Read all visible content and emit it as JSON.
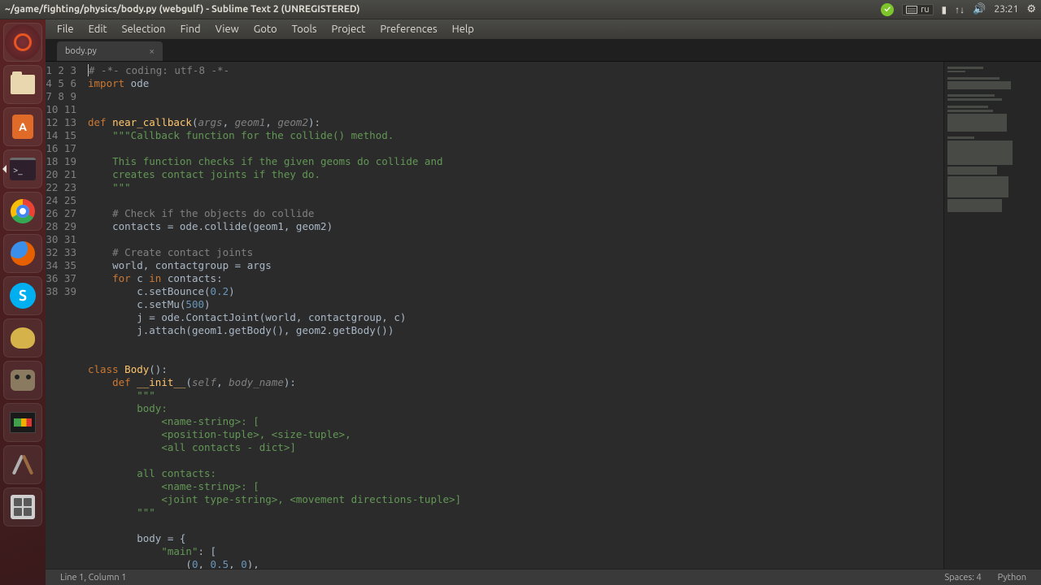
{
  "window": {
    "title": "~/game/fighting/physics/body.py (webgulf) - Sublime Text 2 (UNREGISTERED)"
  },
  "topstatus": {
    "check": "✓",
    "lang": "ru",
    "battery": "▮",
    "updown": "↑↓",
    "sound": "🔊",
    "time": "23:21",
    "gear": "⚙"
  },
  "menubar": [
    "File",
    "Edit",
    "Selection",
    "Find",
    "View",
    "Goto",
    "Tools",
    "Project",
    "Preferences",
    "Help"
  ],
  "tab": {
    "name": "body.py",
    "close": "×"
  },
  "launcher": [
    "ubuntu-dash",
    "files",
    "software-center",
    "terminal",
    "chrome",
    "firefox",
    "skype",
    "teapot",
    "gimp",
    "system-monitor",
    "settings",
    "calculator"
  ],
  "gutter_start": 1,
  "gutter_end": 39,
  "code": [
    {
      "segs": [
        [
          "comment",
          "# -*- coding: utf-8 -*-"
        ]
      ],
      "cursor": true
    },
    {
      "segs": [
        [
          "keyword",
          "import"
        ],
        [
          "def",
          " ode"
        ]
      ]
    },
    {
      "segs": []
    },
    {
      "segs": []
    },
    {
      "segs": [
        [
          "keyword",
          "def"
        ],
        [
          "def",
          " "
        ],
        [
          "name",
          "near_callback"
        ],
        [
          "punc",
          "("
        ],
        [
          "pa",
          "args"
        ],
        [
          "punc",
          ", "
        ],
        [
          "pa",
          "geom1"
        ],
        [
          "punc",
          ", "
        ],
        [
          "pa",
          "geom2"
        ],
        [
          "punc",
          "):"
        ]
      ]
    },
    {
      "segs": [
        [
          "def",
          "    "
        ],
        [
          "string",
          "\"\"\"Callback function for the collide() method."
        ]
      ]
    },
    {
      "segs": []
    },
    {
      "segs": [
        [
          "def",
          "    "
        ],
        [
          "string",
          "This function checks if the given geoms do collide and"
        ]
      ]
    },
    {
      "segs": [
        [
          "def",
          "    "
        ],
        [
          "string",
          "creates contact joints if they do."
        ]
      ]
    },
    {
      "segs": [
        [
          "def",
          "    "
        ],
        [
          "string",
          "\"\"\""
        ]
      ]
    },
    {
      "segs": []
    },
    {
      "segs": [
        [
          "def",
          "    "
        ],
        [
          "comment",
          "# Check if the objects do collide"
        ]
      ]
    },
    {
      "segs": [
        [
          "def",
          "    contacts "
        ],
        [
          "punc",
          "="
        ],
        [
          "def",
          " ode.collide"
        ],
        [
          "punc",
          "("
        ],
        [
          "def",
          "geom1"
        ],
        [
          "punc",
          ", "
        ],
        [
          "def",
          "geom2"
        ],
        [
          "punc",
          ")"
        ]
      ]
    },
    {
      "segs": []
    },
    {
      "segs": [
        [
          "def",
          "    "
        ],
        [
          "comment",
          "# Create contact joints"
        ]
      ]
    },
    {
      "segs": [
        [
          "def",
          "    world"
        ],
        [
          "punc",
          ", "
        ],
        [
          "def",
          "contactgroup "
        ],
        [
          "punc",
          "="
        ],
        [
          "def",
          " args"
        ]
      ]
    },
    {
      "segs": [
        [
          "def",
          "    "
        ],
        [
          "keyword",
          "for"
        ],
        [
          "def",
          " c "
        ],
        [
          "keyword",
          "in"
        ],
        [
          "def",
          " contacts"
        ],
        [
          "punc",
          ":"
        ]
      ]
    },
    {
      "segs": [
        [
          "def",
          "        c.setBounce"
        ],
        [
          "punc",
          "("
        ],
        [
          "number",
          "0.2"
        ],
        [
          "punc",
          ")"
        ]
      ]
    },
    {
      "segs": [
        [
          "def",
          "        c.setMu"
        ],
        [
          "punc",
          "("
        ],
        [
          "number",
          "500"
        ],
        [
          "punc",
          ")"
        ]
      ]
    },
    {
      "segs": [
        [
          "def",
          "        j "
        ],
        [
          "punc",
          "="
        ],
        [
          "def",
          " ode.ContactJoint"
        ],
        [
          "punc",
          "("
        ],
        [
          "def",
          "world"
        ],
        [
          "punc",
          ", "
        ],
        [
          "def",
          "contactgroup"
        ],
        [
          "punc",
          ", "
        ],
        [
          "def",
          "c"
        ],
        [
          "punc",
          ")"
        ]
      ]
    },
    {
      "segs": [
        [
          "def",
          "        j.attach"
        ],
        [
          "punc",
          "("
        ],
        [
          "def",
          "geom1.getBody"
        ],
        [
          "punc",
          "()"
        ],
        [
          "punc",
          ", "
        ],
        [
          "def",
          "geom2.getBody"
        ],
        [
          "punc",
          "())"
        ]
      ]
    },
    {
      "segs": []
    },
    {
      "segs": []
    },
    {
      "segs": [
        [
          "keyword",
          "class"
        ],
        [
          "def",
          " "
        ],
        [
          "name",
          "Body"
        ],
        [
          "punc",
          "():"
        ]
      ]
    },
    {
      "segs": [
        [
          "def",
          "    "
        ],
        [
          "keyword",
          "def"
        ],
        [
          "def",
          " "
        ],
        [
          "name",
          "__init__"
        ],
        [
          "punc",
          "("
        ],
        [
          "pa",
          "self"
        ],
        [
          "punc",
          ", "
        ],
        [
          "pa",
          "body_name"
        ],
        [
          "punc",
          "):"
        ]
      ]
    },
    {
      "segs": [
        [
          "def",
          "        "
        ],
        [
          "string",
          "\"\"\""
        ]
      ]
    },
    {
      "segs": [
        [
          "def",
          "        "
        ],
        [
          "string",
          "body:"
        ]
      ]
    },
    {
      "segs": [
        [
          "def",
          "            "
        ],
        [
          "string",
          "<name-string>: ["
        ]
      ]
    },
    {
      "segs": [
        [
          "def",
          "            "
        ],
        [
          "string",
          "<position-tuple>, <size-tuple>,"
        ]
      ]
    },
    {
      "segs": [
        [
          "def",
          "            "
        ],
        [
          "string",
          "<all contacts - dict>]"
        ]
      ]
    },
    {
      "segs": []
    },
    {
      "segs": [
        [
          "def",
          "        "
        ],
        [
          "string",
          "all contacts:"
        ]
      ]
    },
    {
      "segs": [
        [
          "def",
          "            "
        ],
        [
          "string",
          "<name-string>: ["
        ]
      ]
    },
    {
      "segs": [
        [
          "def",
          "            "
        ],
        [
          "string",
          "<joint type-string>, <movement directions-tuple>]"
        ]
      ]
    },
    {
      "segs": [
        [
          "def",
          "        "
        ],
        [
          "string",
          "\"\"\""
        ]
      ]
    },
    {
      "segs": []
    },
    {
      "segs": [
        [
          "def",
          "        body "
        ],
        [
          "punc",
          "="
        ],
        [
          "def",
          " "
        ],
        [
          "punc",
          "{"
        ]
      ]
    },
    {
      "segs": [
        [
          "def",
          "            "
        ],
        [
          "string",
          "\"main\""
        ],
        [
          "punc",
          ": ["
        ]
      ]
    },
    {
      "segs": [
        [
          "def",
          "                "
        ],
        [
          "punc",
          "("
        ],
        [
          "number",
          "0"
        ],
        [
          "punc",
          ", "
        ],
        [
          "number",
          "0.5"
        ],
        [
          "punc",
          ", "
        ],
        [
          "number",
          "0"
        ],
        [
          "punc",
          "),"
        ]
      ]
    }
  ],
  "statusbar": {
    "pos": "Line 1, Column 1",
    "spaces": "Spaces: 4",
    "syntax": "Python"
  }
}
